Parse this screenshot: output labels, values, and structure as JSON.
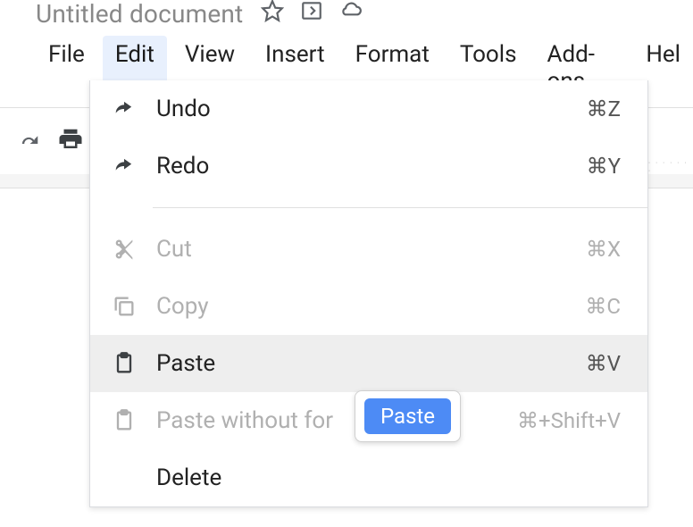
{
  "doc": {
    "title": "Untitled document"
  },
  "menubar": {
    "items": [
      {
        "label": "File"
      },
      {
        "label": "Edit"
      },
      {
        "label": "View"
      },
      {
        "label": "Insert"
      },
      {
        "label": "Format"
      },
      {
        "label": "Tools"
      },
      {
        "label": "Add-ons"
      },
      {
        "label": "Hel"
      }
    ]
  },
  "dropdown": {
    "items": [
      {
        "label": "Undo",
        "shortcut": "⌘Z"
      },
      {
        "label": "Redo",
        "shortcut": "⌘Y"
      },
      {
        "label": "Cut",
        "shortcut": "⌘X"
      },
      {
        "label": "Copy",
        "shortcut": "⌘C"
      },
      {
        "label": "Paste",
        "shortcut": "⌘V"
      },
      {
        "label": "Paste without for",
        "shortcut": "⌘+Shift+V"
      },
      {
        "label": "Delete",
        "shortcut": ""
      }
    ]
  },
  "tooltip": {
    "text": "Paste"
  }
}
